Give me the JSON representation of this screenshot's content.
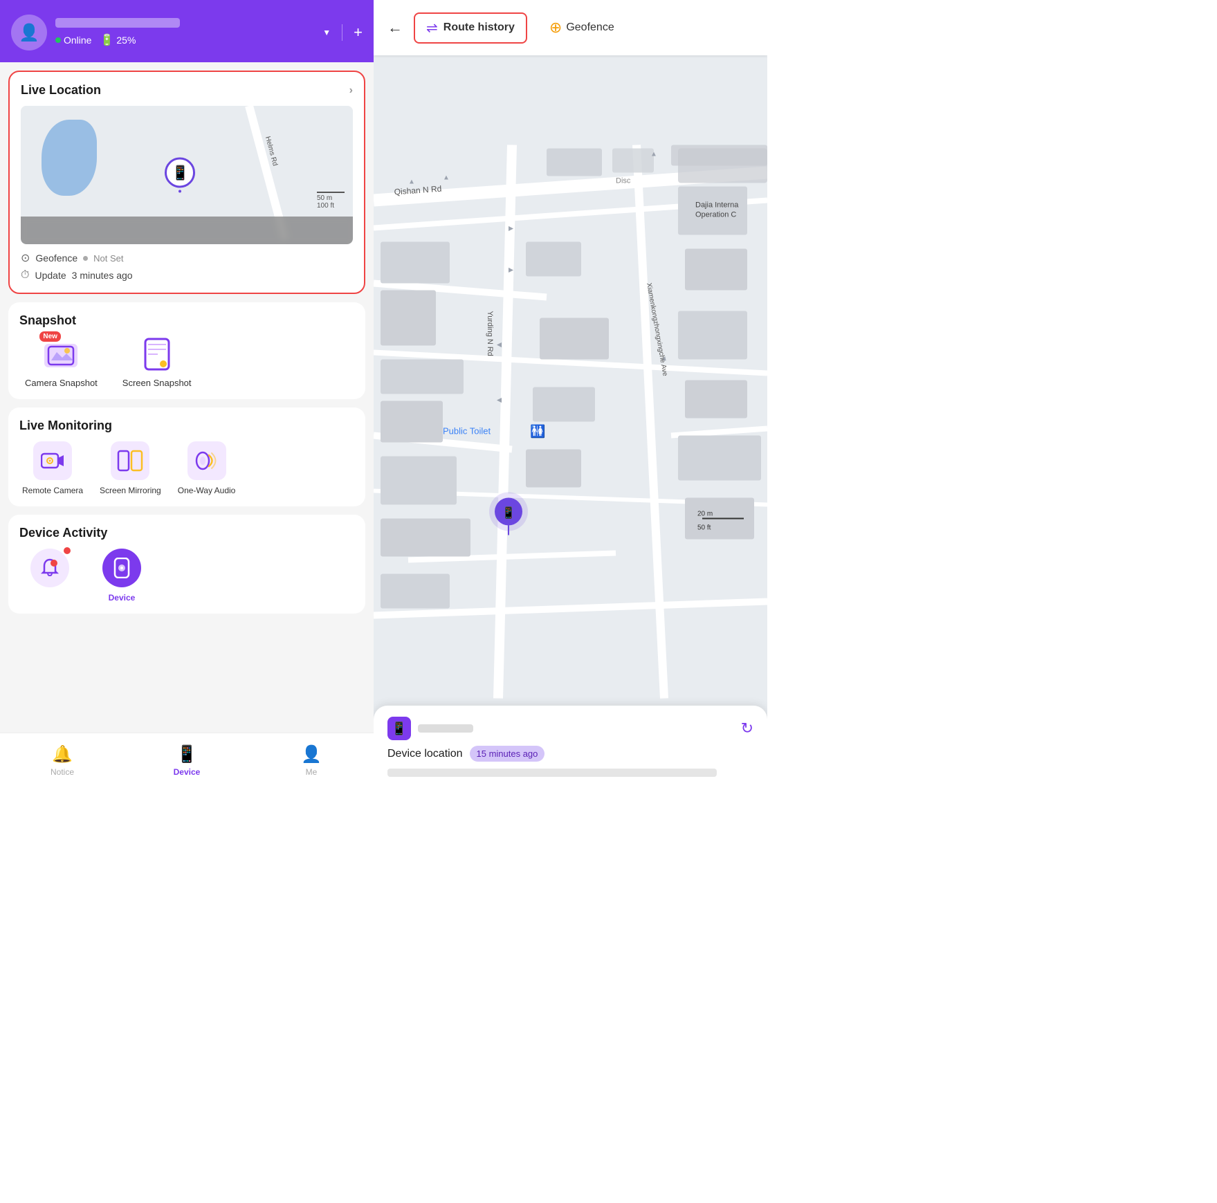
{
  "header": {
    "avatar_alt": "User avatar",
    "status": "Online",
    "battery": "25%",
    "dropdown_label": "▼",
    "add_label": "+"
  },
  "live_location": {
    "title": "Live Location",
    "chevron": "›",
    "road_label": "Helms Rd",
    "scale_50m": "50 m",
    "scale_100ft": "100 ft",
    "geofence_label": "Geofence",
    "not_set": "Not Set",
    "update_label": "Update",
    "update_time": "3 minutes ago"
  },
  "snapshot": {
    "title": "Snapshot",
    "camera_new": "New",
    "camera_label": "Camera Snapshot",
    "screen_label": "Screen Snapshot"
  },
  "live_monitoring": {
    "title": "Live Monitoring",
    "remote_camera": "Remote Camera",
    "screen_mirroring": "Screen Mirroring",
    "one_way_audio": "One-Way Audio"
  },
  "device_activity": {
    "title": "Device Activity"
  },
  "bottom_nav": {
    "notice": "Notice",
    "device": "Device",
    "me": "Me"
  },
  "right_panel": {
    "back_label": "←",
    "route_history": "Route history",
    "geofence": "Geofence",
    "qishan_label": "Qishan N Rd",
    "disc_label": "Disc",
    "dajia_label": "Dajia Interna\nOperation C",
    "public_toilet": "Public Toilet",
    "yurding_label": "Yurding N Rd",
    "xiamenkong_label": "Xiamenkongzhongxingche Ave",
    "scale_20m": "20 m",
    "scale_50ft": "50 ft",
    "device_location": "Device location",
    "time_ago": "15 minutes ago",
    "refresh_icon": "↻"
  }
}
